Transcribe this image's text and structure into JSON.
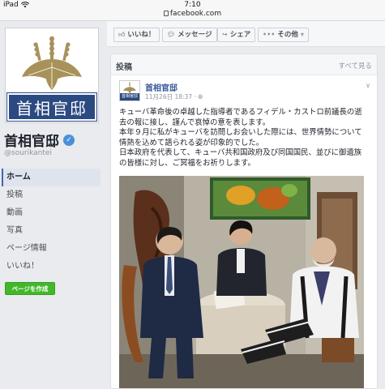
{
  "status_bar": {
    "device": "iPad",
    "time": "7:10",
    "url": "facebook.com"
  },
  "page": {
    "name": "首相官邸",
    "handle": "@sourikantei",
    "profile_band_text": "首相官邸"
  },
  "nav": {
    "items": [
      {
        "label": "ホーム",
        "active": true
      },
      {
        "label": "投稿"
      },
      {
        "label": "動画"
      },
      {
        "label": "写真"
      },
      {
        "label": "ページ情報"
      },
      {
        "label": "いいね！"
      }
    ],
    "create_page_label": "ページを作成"
  },
  "actions": {
    "like": "いいね！",
    "message": "メッセージ",
    "share": "シェア",
    "more": "その他"
  },
  "posts_section": {
    "title": "投稿",
    "see_all": "すべて見る"
  },
  "post": {
    "author": "首相官邸",
    "timestamp": "11月26日 18:37",
    "lines": [
      "キューバ革命後の卓越した指導者であるフィデル・カストロ前議長の逝",
      "去の報に接し、謹んで哀悼の意を表します。",
      "本年９月に私がキューバを訪問しお会いした際には、世界情勢について",
      "情熱を込めて語られる姿が印象的でした。",
      "日本政府を代表して、キューバ共和国政府及び同国国民、並びに御遺族",
      "の皆様に対し、ご冥福をお祈りします。"
    ]
  },
  "colors": {
    "brand_blue": "#4267b2",
    "link_blue": "#365899",
    "create_green": "#42b72a",
    "profile_band": "#2c4a82"
  }
}
